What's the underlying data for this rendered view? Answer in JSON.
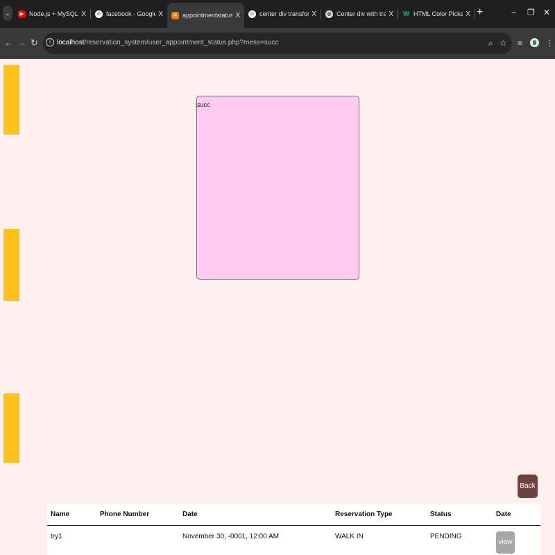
{
  "browser": {
    "tabs": [
      {
        "title": "Node.js + MySQL CRUD - C",
        "favicon": "youtube-icon",
        "color": "#ff0000"
      },
      {
        "title": "facebook - Google Search",
        "favicon": "google-icon",
        "color": "#4285f4"
      },
      {
        "title": "appointmentstatus",
        "favicon": "xampp-icon",
        "color": "#f57c00",
        "active": true
      },
      {
        "title": "center div transform transi",
        "favicon": "google-icon",
        "color": "#4285f4"
      },
      {
        "title": "Center div with transform",
        "favicon": "chatgpt-icon",
        "color": "#e0e0e0"
      },
      {
        "title": "HTML Color Picker",
        "favicon": "w3schools-icon",
        "color": "#04aa6d"
      }
    ],
    "tab_close": "X",
    "url_host": "localhost",
    "url_path": "/reservation_system/user_appointment_status.php?mess=succ"
  },
  "page": {
    "message": "succ",
    "back_label": "Back",
    "table": {
      "headers": [
        "Name",
        "Phone Number",
        "Date",
        "Reservation Type",
        "Status",
        "Date"
      ],
      "rows": [
        {
          "name": "try1",
          "phone": "",
          "date": "November 30, -0001, 12:00 AM",
          "type": "WALK IN",
          "status": "PENDING",
          "action": "view"
        }
      ]
    }
  },
  "colors": {
    "page_bg": "#fdf0ee",
    "accent_bar": "#ffc21a",
    "message_box": "#ffccf1",
    "back_button": "#6e423f",
    "view_button": "#a6a6a6"
  }
}
